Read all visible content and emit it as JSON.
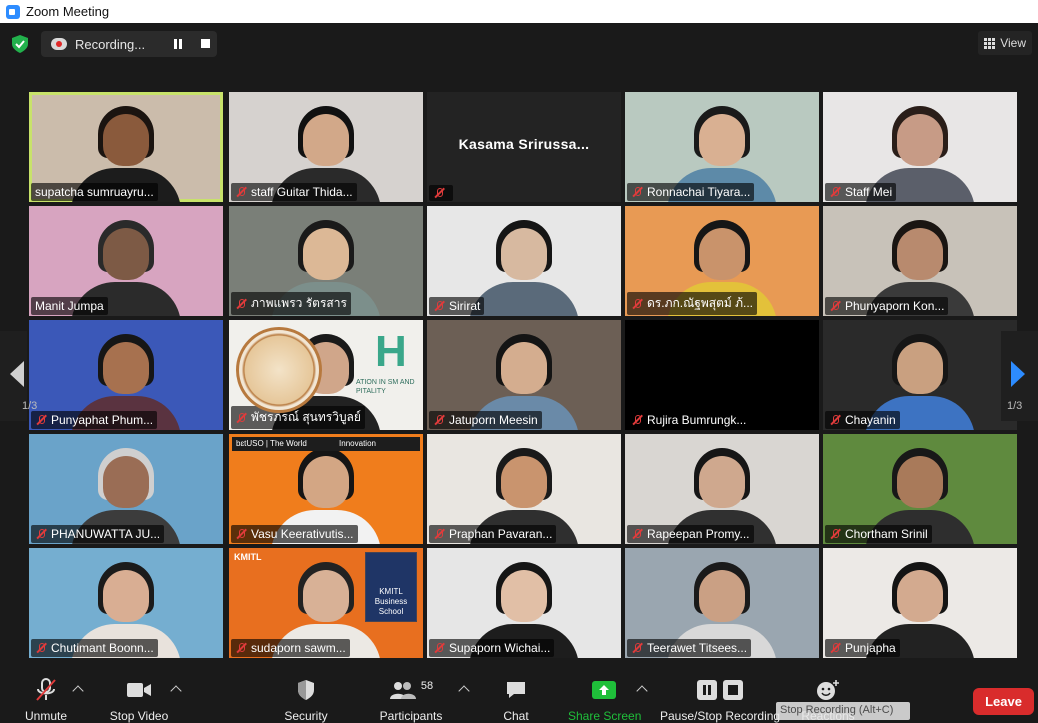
{
  "window": {
    "title": "Zoom Meeting"
  },
  "recording": {
    "label": "Recording..."
  },
  "view": {
    "label": "View"
  },
  "pagination": {
    "left": "1/3",
    "right": "1/3"
  },
  "participants_grid": [
    {
      "name": "supatcha sumruayru...",
      "muted": false,
      "active": true,
      "video": true,
      "bg": "#cbbcab",
      "skin": "#8a5a3c",
      "hair": "#1b1410",
      "shirt": "#1c1c1c"
    },
    {
      "name": "staff Guitar Thida...",
      "muted": true,
      "video": true,
      "bg": "#d6d2cf",
      "skin": "#d2a889",
      "hair": "#111111",
      "shirt": "#2a2a2a"
    },
    {
      "name": "Kasama Srirussa...",
      "muted": true,
      "video": false,
      "bg": "#232323"
    },
    {
      "name": "Ronnachai Tiyara...",
      "muted": true,
      "video": true,
      "bg": "#b9c9c0",
      "skin": "#d9b092",
      "hair": "#1a1a1a",
      "shirt": "#5d8aa8"
    },
    {
      "name": "Staff Mei",
      "muted": true,
      "video": true,
      "bg": "#e8e6e6",
      "skin": "#c79b86",
      "hair": "#2a1e19",
      "shirt": "#5b5f6a"
    },
    {
      "name": "Manit Jumpa",
      "muted": false,
      "video": true,
      "bg": "#d7a4c0",
      "skin": "#7d5a45",
      "hair": "#2a2a2a",
      "shirt": "#2b2b2b"
    },
    {
      "name": "ภาพแพรว รัตรสาร",
      "muted": true,
      "video": true,
      "bg": "#7a7f78",
      "skin": "#dcb896",
      "hair": "#1a1a1a",
      "shirt": "#7c8f8b"
    },
    {
      "name": "Sirirat",
      "muted": true,
      "video": true,
      "bg": "#e7e7e7",
      "skin": "#d7b9a0",
      "hair": "#151515",
      "shirt": "#5a6a7a"
    },
    {
      "name": "ดร.ภก.ณัฐพสุตม์ ภ้...",
      "muted": true,
      "video": true,
      "bg": "#e89a54",
      "skin": "#c9936b",
      "hair": "#161616",
      "shirt": "#e3c13a"
    },
    {
      "name": "Phunyaporn Kon...",
      "muted": true,
      "video": true,
      "bg": "#c8c2b9",
      "skin": "#b88a6e",
      "hair": "#1a1512",
      "shirt": "#3a3a3a"
    },
    {
      "name": "Punyaphat Phum...",
      "muted": true,
      "video": true,
      "bg": "#3b58b8",
      "skin": "#a7714f",
      "hair": "#161616",
      "shirt": "#5a3340"
    },
    {
      "name": "พัชรภรณ์ สุนทรวิบูลย์",
      "muted": true,
      "video": true,
      "bg": "#f1f0ec",
      "skin": "#d0a68a",
      "hair": "#1a1a1a",
      "shirt": "#222222"
    },
    {
      "name": "Jatuporn Meesin",
      "muted": true,
      "video": true,
      "bg": "#6c5f55",
      "skin": "#d4ad8f",
      "hair": "#141414",
      "shirt": "#6a8aa8"
    },
    {
      "name": "Rujira Bumrungk...",
      "muted": true,
      "video": false,
      "bg": "#000000"
    },
    {
      "name": "Chayanin",
      "muted": true,
      "video": true,
      "bg": "#2a2a2a",
      "skin": "#c9a080",
      "hair": "#161616",
      "shirt": "#3d73c2"
    },
    {
      "name": "PHANUWATTA JU...",
      "muted": true,
      "video": true,
      "bg": "#6aa3c9",
      "skin": "#9a6d55",
      "hair": "#cfcfcf",
      "shirt": "#3c3c3c"
    },
    {
      "name": "Vasu Keerativutis...",
      "muted": true,
      "video": true,
      "bg": "#f07d1c",
      "skin": "#d3a684",
      "hair": "#151515",
      "shirt": "#f2f2f2"
    },
    {
      "name": "Praphan Pavaran...",
      "muted": true,
      "video": true,
      "bg": "#e9e6e1",
      "skin": "#c9946e",
      "hair": "#1a1a1a",
      "shirt": "#2f2f2f"
    },
    {
      "name": "Rapeepan Promy...",
      "muted": true,
      "video": true,
      "bg": "#d9d6d2",
      "skin": "#cfa88e",
      "hair": "#161616",
      "shirt": "#303030"
    },
    {
      "name": "Chortham Srinil",
      "muted": true,
      "video": true,
      "bg": "#5f8a3e",
      "skin": "#a97a5a",
      "hair": "#181818",
      "shirt": "#2e2e2e"
    },
    {
      "name": "Chutimant Boonn...",
      "muted": true,
      "video": true,
      "bg": "#75aed0",
      "skin": "#d9ae93",
      "hair": "#1b1b1b",
      "shirt": "#e8e2dc"
    },
    {
      "name": "sudaporn sawm...",
      "muted": true,
      "video": true,
      "bg": "#e86f1f",
      "skin": "#d8b196",
      "hair": "#222222",
      "shirt": "#ece9e4"
    },
    {
      "name": "Supaporn Wichai...",
      "muted": true,
      "video": true,
      "bg": "#e6e6e6",
      "skin": "#e1bfa6",
      "hair": "#151515",
      "shirt": "#1d1d1d"
    },
    {
      "name": "Teerawet Titsees...",
      "muted": true,
      "video": true,
      "bg": "#9aa6b0",
      "skin": "#caa084",
      "hair": "#1a1a1a",
      "shirt": "#d8d8d8"
    },
    {
      "name": "Punjapha",
      "muted": true,
      "video": true,
      "bg": "#ece9e6",
      "skin": "#d3aa8f",
      "hair": "#141414",
      "shirt": "#222222"
    }
  ],
  "tile_overlays": {
    "banner_vasu": "bɛtUSO | The World",
    "banner_vasu2": "Innovation",
    "banner_sudaporn": "KMITL Business School",
    "banner_sudaporn_top": "KMITL",
    "banner_patcharaporn": "H",
    "banner_patcharaporn_sub": "ATION IN SM AND PITALITY"
  },
  "toolbar": {
    "unmute": "Unmute",
    "stop_video": "Stop Video",
    "security": "Security",
    "participants": "Participants",
    "participants_count": "58",
    "chat": "Chat",
    "share_screen": "Share Screen",
    "pause_stop_recording": "Pause/Stop Recording",
    "reactions": "Reactions",
    "leave": "Leave",
    "tooltip": "Stop Recording (Alt+C)"
  },
  "colors": {
    "accent_blue": "#2d8cff",
    "leave_red": "#d92c2c",
    "share_green": "#1fbf3a",
    "active_speaker": "#c8e26a",
    "muted_red": "#e03b3b"
  }
}
